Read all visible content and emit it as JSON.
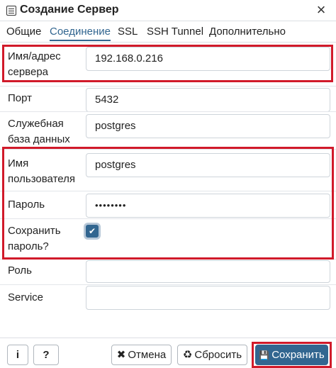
{
  "dialog": {
    "title": "Создание Сервер",
    "close_glyph": "×"
  },
  "tabs": [
    {
      "label": "Общие",
      "active": false
    },
    {
      "label": "Соединение",
      "active": true
    },
    {
      "label": "SSL",
      "active": false
    },
    {
      "label": "SSH Tunnel",
      "active": false
    },
    {
      "label": "Дополнительно",
      "active": false
    }
  ],
  "form": {
    "host": {
      "label": "Имя/адрес сервера",
      "value": "192.168.0.216"
    },
    "port": {
      "label": "Порт",
      "value": "5432"
    },
    "maintenance_db": {
      "label": "Служебная база данных",
      "value": "postgres"
    },
    "username": {
      "label": "Имя пользователя",
      "value": "postgres"
    },
    "password": {
      "label": "Пароль",
      "value": "••••••••"
    },
    "save_password": {
      "label": "Сохранить пароль?",
      "checked": true,
      "check_glyph": "✔"
    },
    "role": {
      "label": "Роль",
      "value": ""
    },
    "service": {
      "label": "Service",
      "value": ""
    }
  },
  "footer": {
    "info_glyph": "i",
    "help_glyph": "?",
    "cancel_icon": "✖",
    "cancel_label": "Отмена",
    "reset_icon": "♻",
    "reset_label": "Сбросить",
    "save_icon": "💾",
    "save_label": "Сохранить"
  },
  "colors": {
    "accent": "#326690",
    "highlight": "#d11a2a"
  }
}
